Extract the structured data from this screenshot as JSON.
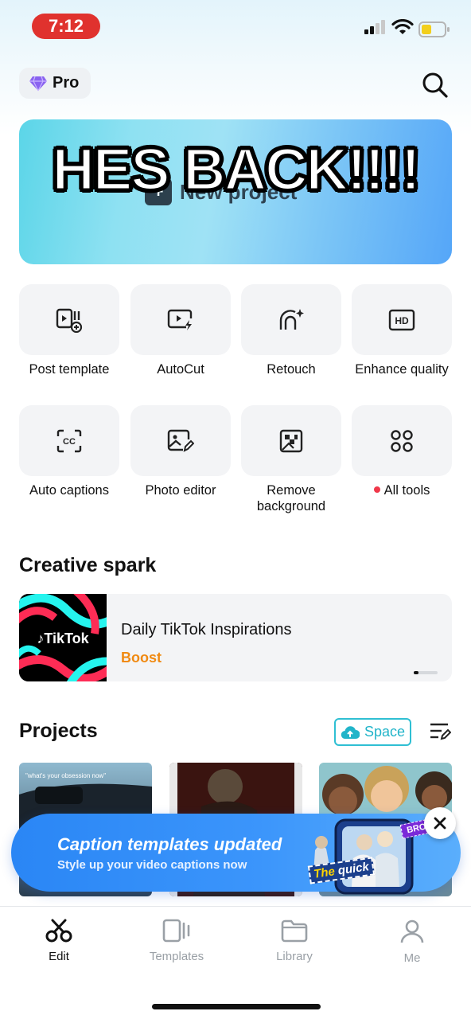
{
  "status_bar": {
    "time": "7:12"
  },
  "header": {
    "pro_label": "Pro"
  },
  "banner": {
    "ghost_text": "New project",
    "overlay_caption": "HES BACK!!!!"
  },
  "tools": [
    {
      "label": "Post template",
      "icon": "post-template-icon"
    },
    {
      "label": "AutoCut",
      "icon": "autocut-icon"
    },
    {
      "label": "Retouch",
      "icon": "retouch-icon"
    },
    {
      "label": "Enhance quality",
      "icon": "hd-icon"
    },
    {
      "label": "Auto captions",
      "icon": "captions-icon"
    },
    {
      "label": "Photo editor",
      "icon": "photo-editor-icon"
    },
    {
      "label": "Remove background",
      "icon": "remove-bg-icon"
    },
    {
      "label": "All tools",
      "icon": "grid-icon"
    }
  ],
  "creative_spark": {
    "title": "Creative spark",
    "card": {
      "brand": "TikTok",
      "title": "Daily TikTok Inspirations",
      "subtitle": "Boost"
    }
  },
  "projects": {
    "title": "Projects",
    "space_label": "Space",
    "items": [
      {
        "caption": "\"what's your obsession now\""
      },
      {
        "caption": ""
      },
      {
        "caption": ""
      }
    ]
  },
  "toast": {
    "title": "Caption templates updated",
    "subtitle": "Style up your video captions now",
    "art_tag1": "The",
    "art_tag2": "quick",
    "art_tag3": "BROWN"
  },
  "tabs": [
    {
      "label": "Edit",
      "active": true
    },
    {
      "label": "Templates",
      "active": false
    },
    {
      "label": "Library",
      "active": false
    },
    {
      "label": "Me",
      "active": false
    }
  ],
  "colors": {
    "accent": "#21b4c9",
    "boost": "#f08a12",
    "toast": "#2a86f5",
    "time_pill": "#e0322e"
  }
}
